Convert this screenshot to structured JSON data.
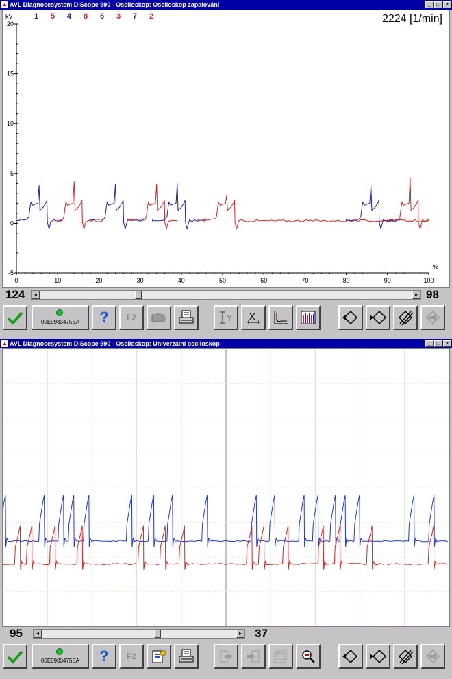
{
  "windows": [
    {
      "title": "AVL Diagnosesystem DiScope 990 - Osciloskop: Osciloskop zapalování",
      "rpm": "2224 [1/min]",
      "scroll_left": "124",
      "scroll_right": "98",
      "scroll_position": 0.26,
      "serial": "00E0983475EA",
      "f2_label": "F2"
    },
    {
      "title": "AVL Diagnosesystem DiScope 990 - Osciloskop: Univerzální osciloskop",
      "scroll_left": "95",
      "scroll_right": "37",
      "scroll_position": 0.6,
      "serial": "00E0983475EA",
      "f2_label": "F2"
    }
  ],
  "chart_data": [
    {
      "type": "line",
      "ylabel": "kV",
      "xlabel": "%",
      "ylim": [
        -5,
        20
      ],
      "xlim": [
        0,
        100
      ],
      "y_ticks": [
        "20",
        "15",
        "10",
        "5",
        "0",
        "-5"
      ],
      "x_ticks": [
        "0",
        "10",
        "20",
        "30",
        "40",
        "50",
        "60",
        "70",
        "80",
        "90",
        "100"
      ],
      "cylinder_labels": [
        "1",
        "5",
        "4",
        "8",
        "6",
        "3",
        "7",
        "2"
      ],
      "series_colors": [
        "#2020b0",
        "#e02020",
        "#2020b0",
        "#e02020",
        "#2020b0",
        "#e02020",
        "#2020b0",
        "#e02020"
      ],
      "series": [
        {
          "name": "1",
          "color": "#2020b0",
          "start": 0,
          "spike_at": 5.5,
          "peak": 3.8,
          "end": 11
        },
        {
          "name": "5",
          "color": "#e02020",
          "start": 10,
          "spike_at": 14,
          "peak": 4.2,
          "end": 21
        },
        {
          "name": "4",
          "color": "#2020b0",
          "start": 18,
          "spike_at": 24,
          "peak": 3.9,
          "end": 31
        },
        {
          "name": "8",
          "color": "#e02020",
          "start": 27,
          "spike_at": 34,
          "peak": 3.9,
          "end": 39
        },
        {
          "name": "6",
          "color": "#2020b0",
          "start": 33,
          "spike_at": 39,
          "peak": 4.0,
          "end": 46
        },
        {
          "name": "3",
          "color": "#e02020",
          "start": 44,
          "spike_at": 51,
          "peak": 2.8,
          "end": 100
        },
        {
          "name": "7",
          "color": "#2020b0",
          "start": 80,
          "spike_at": 86,
          "peak": 3.8,
          "end": 93
        },
        {
          "name": "2",
          "color": "#e02020",
          "start": 90,
          "spike_at": 95.5,
          "peak": 4.6,
          "end": 100
        }
      ],
      "grid": false
    },
    {
      "type": "line",
      "grid": true,
      "series": [
        {
          "color": "#2038d0",
          "baseline": 0.0,
          "peaks_at": [
            0.6,
            9.3,
            13.6,
            15.9,
            19.3,
            28.9,
            33.8,
            38.0,
            45.8,
            56.8,
            60.9,
            67.5,
            70.6,
            74.5,
            76.7,
            79.9,
            92.1,
            96.6
          ],
          "peak": 2.4
        },
        {
          "color": "#e02020",
          "baseline": -1.2,
          "peaks_at": [
            3.9,
            6.5,
            11.7,
            17.8,
            31.5,
            36.4,
            40.7,
            55.8,
            58.5,
            63.9,
            71.8,
            75.5,
            82.7,
            96.5
          ],
          "peak": 0.8
        }
      ]
    }
  ]
}
